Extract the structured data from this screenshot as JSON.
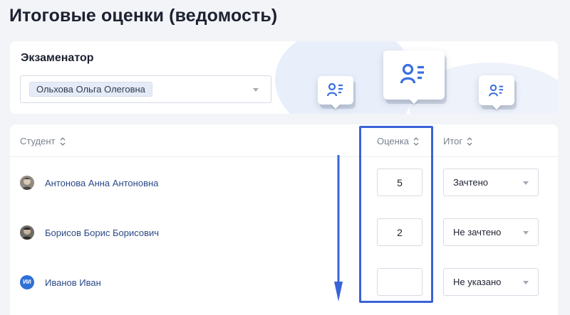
{
  "page": {
    "title": "Итоговые оценки (ведомость)"
  },
  "examiner": {
    "label": "Экзаменатор",
    "selected": "Ольхова Ольга Олеговна"
  },
  "table": {
    "columns": {
      "student": "Студент",
      "grade": "Оценка",
      "result": "Итог"
    },
    "rows": [
      {
        "name": "Антонова Анна Антоновна",
        "grade": "5",
        "result": "Зачтено",
        "avatar": "photo"
      },
      {
        "name": "Борисов Борис Борисович",
        "grade": "2",
        "result": "Не зачтено",
        "avatar": "photo"
      },
      {
        "name": "Иванов Иван",
        "grade": "",
        "result": "Не указано",
        "avatar": "initials",
        "initials": "ИИ"
      }
    ]
  },
  "colors": {
    "accent": "#3a63d8",
    "link": "#2c4a86",
    "background": "#f2f4f8"
  }
}
